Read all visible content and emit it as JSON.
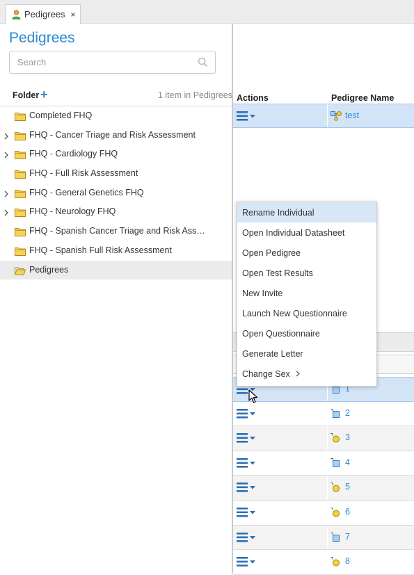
{
  "tab": {
    "label": "Pedigrees",
    "close": "×",
    "icon": "person-icon"
  },
  "header": {
    "title": "Pedigrees"
  },
  "search": {
    "placeholder": "Search",
    "value": ""
  },
  "folder_panel": {
    "label": "Folder",
    "add_icon": "+",
    "item_count": "1 item in Pedigrees",
    "folders": [
      {
        "label": "Completed FHQ",
        "expandable": false,
        "selected": false
      },
      {
        "label": "FHQ - Cancer Triage and Risk Assessment",
        "expandable": true,
        "selected": false
      },
      {
        "label": "FHQ - Cardiology FHQ",
        "expandable": true,
        "selected": false
      },
      {
        "label": "FHQ - Full Risk Assessment",
        "expandable": false,
        "selected": false
      },
      {
        "label": "FHQ - General Genetics FHQ",
        "expandable": true,
        "selected": false
      },
      {
        "label": "FHQ - Neurology FHQ",
        "expandable": true,
        "selected": false
      },
      {
        "label": "FHQ - Spanish Cancer Triage and Risk Ass…",
        "expandable": false,
        "selected": false
      },
      {
        "label": "FHQ - Spanish Full Risk Assessment",
        "expandable": false,
        "selected": false
      },
      {
        "label": "Pedigrees",
        "expandable": false,
        "selected": true
      }
    ]
  },
  "grid": {
    "columns": {
      "actions": "Actions",
      "name": "Pedigree Name"
    },
    "top_row": {
      "name": "test",
      "icon": "pedigree-icon"
    },
    "rows": [
      {
        "name": "1",
        "sex": "male",
        "selected": true
      },
      {
        "name": "2",
        "sex": "male",
        "selected": false
      },
      {
        "name": "3",
        "sex": "female",
        "selected": false
      },
      {
        "name": "4",
        "sex": "male",
        "selected": false
      },
      {
        "name": "5",
        "sex": "female",
        "selected": false
      },
      {
        "name": "6",
        "sex": "female",
        "selected": false
      },
      {
        "name": "7",
        "sex": "male",
        "selected": false
      },
      {
        "name": "8",
        "sex": "female",
        "selected": false
      }
    ]
  },
  "context_menu": {
    "items": [
      {
        "label": "Rename Individual",
        "hover": true
      },
      {
        "label": "Open Individual Datasheet"
      },
      {
        "label": "Open Pedigree"
      },
      {
        "label": "Open Test Results"
      },
      {
        "label": "New Invite"
      },
      {
        "label": "Launch New Questionnaire"
      },
      {
        "label": "Open Questionnaire"
      },
      {
        "label": "Generate Letter"
      },
      {
        "label": "Change Sex",
        "submenu": true
      }
    ]
  },
  "colors": {
    "accent": "#2a8ad1",
    "selected_row": "#d4e4f7",
    "folder_fill": "#f7d25a",
    "female_fill": "#f3d23a"
  }
}
